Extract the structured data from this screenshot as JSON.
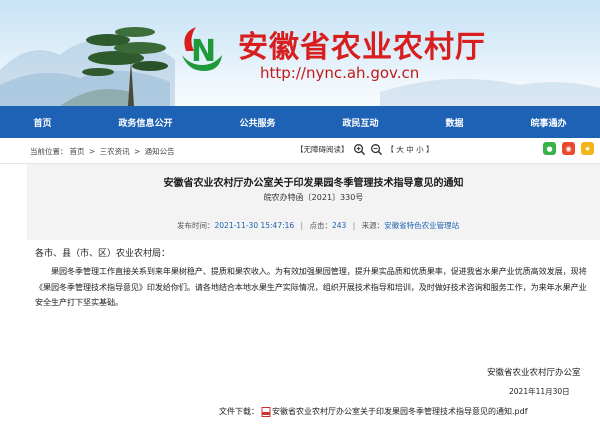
{
  "header": {
    "site_title": "安徽省农业农村厅",
    "site_url": "http://nync.ah.gov.cn"
  },
  "nav": {
    "items": [
      "首页",
      "政务信息公开",
      "公共服务",
      "政民互动",
      "数据",
      "皖事通办"
    ]
  },
  "location": {
    "label": "当前位置：",
    "home": "首页",
    "sep": ">",
    "section": "三农资讯",
    "page": "通知公告"
  },
  "tools": {
    "accessibility": "【无障碍阅读】",
    "font_size": "【 大 中 小 】"
  },
  "share": {
    "colors": {
      "wechat": "#37b34a",
      "weibo": "#e8492f",
      "qzone": "#f4b51b"
    }
  },
  "article": {
    "title": "安徽省农业农村厅办公室关于印发果园冬季管理技术指导意见的通知",
    "doc_number": "皖农办特函〔2021〕330号",
    "published_label": "发布时间：",
    "published_value": "2021-11-30 15:47:16",
    "views_label": "点击：",
    "views_value": "243",
    "source_label": "来源：",
    "source_value": "安徽省特色农业管理站",
    "greeting": "各市、县（市、区）农业农村局：",
    "body": "果园冬季管理工作直接关系到来年果树稳产、提质和果农收入。为有效加强果园管理，提升果实品质和优质果率，促进我省水果产业优质高效发展，现将《果园冬季管理技术指导意见》印发给你们。请各地结合本地水果生产实际情况，组织开展技术指导和培训，及时做好技术咨询和服务工作，为来年水果产业安全生产打下坚实基础。",
    "signature": "安徽省农业农村厅办公室",
    "signature_date": "2021年11月30日",
    "download_label": "文件下载：",
    "download_file": "安徽省农业农村厅办公室关于印发果园冬季管理技术指导意见的通知.pdf"
  }
}
